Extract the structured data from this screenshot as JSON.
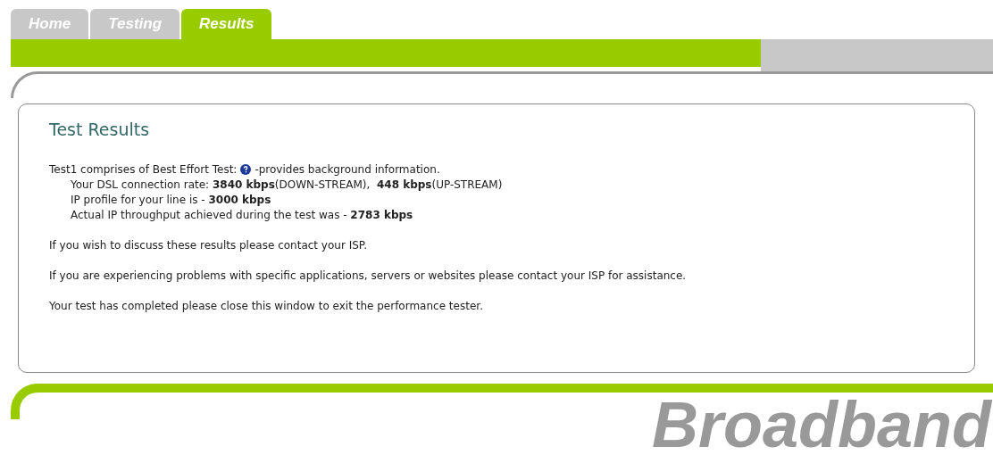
{
  "tabs": [
    {
      "label": "Home",
      "selected": false
    },
    {
      "label": "Testing",
      "selected": false
    },
    {
      "label": "Results",
      "selected": true
    }
  ],
  "panel": {
    "title": "Test Results",
    "intro": {
      "before": "Test1 comprises of Best Effort Test:",
      "after": "-provides background information."
    },
    "details": [
      "Your DSL connection rate: **3840 kbps**(DOWN-STREAM),  **448 kbps**(UP-STREAM)",
      "IP profile for your line is - **3000 kbps**",
      "Actual IP throughput achieved during the test was - **2783 kbps**"
    ],
    "paragraphs": [
      "If you wish to discuss these results please contact your ISP.",
      "If you are experiencing problems with specific applications, servers or websites please contact your ISP for assistance.",
      "Your test has completed please close this window to exit the performance tester."
    ]
  },
  "footer": {
    "brand": "Broadband"
  }
}
